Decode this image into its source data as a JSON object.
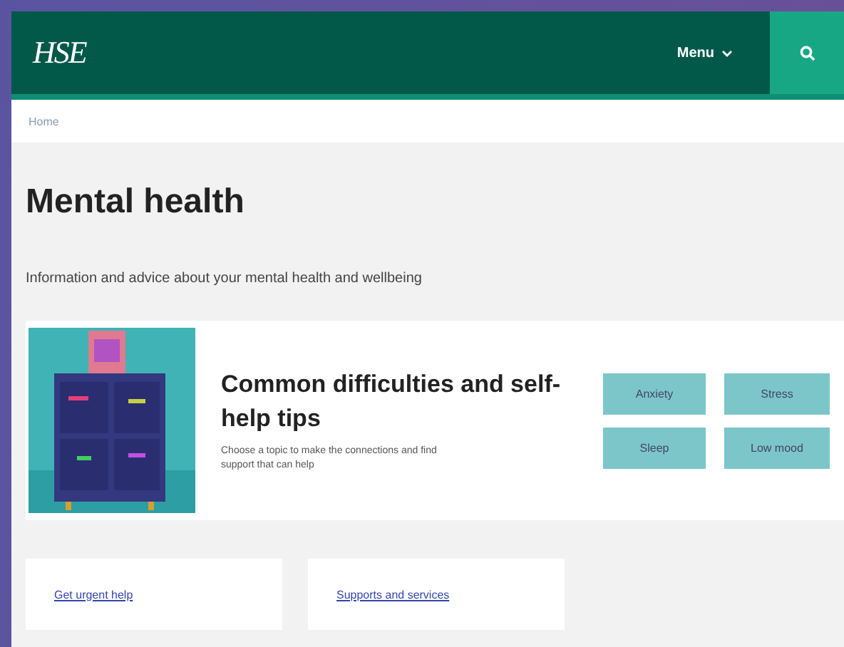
{
  "header": {
    "logo": "HSE",
    "menu": "Menu"
  },
  "breadcrumb": "Home",
  "title": "Mental health",
  "intro": "Information and advice about your mental health and wellbeing",
  "feature": {
    "kind": "picture",
    "heading": "Common difficulties and self-help tips",
    "text": "Choose a topic to make the connections and find support that can help",
    "topics": [
      "Anxiety",
      "Stress",
      "Sleep",
      "Low mood"
    ]
  },
  "links": [
    "Get urgent help",
    "Supports and services"
  ]
}
